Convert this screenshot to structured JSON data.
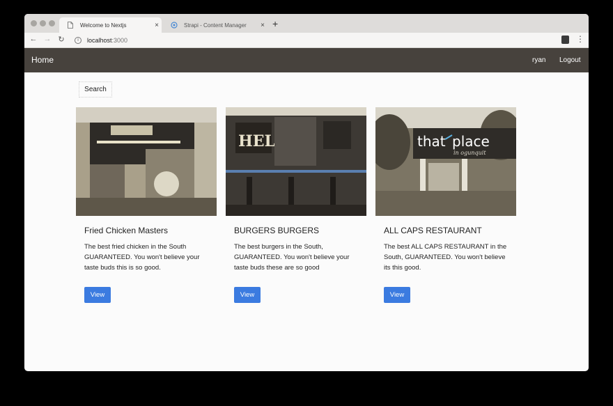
{
  "browser": {
    "tabs": [
      {
        "title": "Welcome to Nextjs",
        "close": "×"
      },
      {
        "title": "Strapi - Content Manager",
        "close": "×"
      }
    ],
    "new_tab": "+",
    "nav": {
      "back": "←",
      "forward": "→",
      "reload": "↻"
    },
    "url_host": "localhost",
    "url_port": ":3000",
    "menu": "⋮"
  },
  "navbar": {
    "brand": "Home",
    "user": "ryan",
    "logout": "Logout"
  },
  "search": {
    "label": "Search"
  },
  "restaurants": [
    {
      "name": "Fried Chicken Masters",
      "description": "The best fried chicken in the South GUARANTEED. You won't believe your taste buds this is so good.",
      "button": "View"
    },
    {
      "name": "BURGERS BURGERS",
      "description": "The best burgers in the South, GUARANTEED. You won't believe your taste buds these are so good",
      "button": "View"
    },
    {
      "name": "ALL CAPS RESTAURANT",
      "description": "The best ALL CAPS RESTAURANT in the South, GUARANTEED. You won't believe its this good.",
      "button": "View"
    }
  ],
  "colors": {
    "navbar": "#47423d",
    "button": "#3b7be0",
    "page": "#fbfbfb"
  }
}
